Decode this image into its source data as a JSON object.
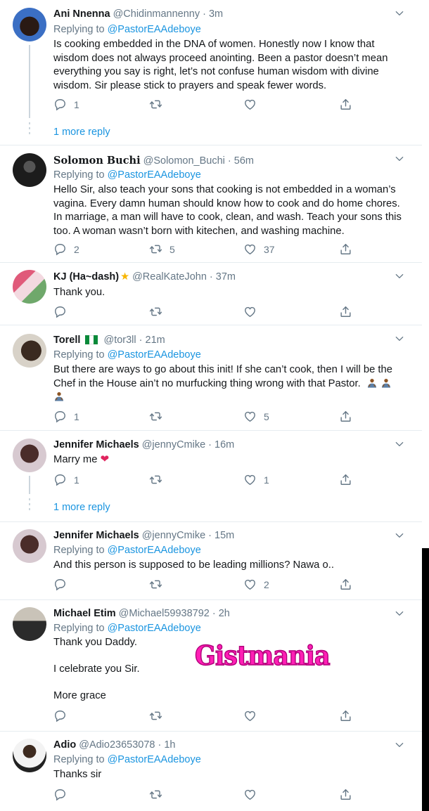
{
  "tweets": [
    {
      "name": "Ani Nnenna",
      "handle": "@Chidinmannenny · 3m",
      "replying": "Replying to ",
      "mention": "@PastorEAAdeboye",
      "text": "Is cooking embedded in the DNA of women. Honestly now I know that wisdom does not always proceed anointing. Been a pastor doesn’t mean everything you say is right, let’s not confuse human wisdom with divine wisdom.  Sir please stick to prayers and speak fewer words.",
      "replies": "1",
      "retweets": "",
      "likes": ""
    },
    {
      "name": "Solomon Buchi",
      "handle": "@Solomon_Buchi · 56m",
      "replying": "Replying to ",
      "mention": "@PastorEAAdeboye",
      "text": "Hello Sir, also teach your sons that cooking is not embedded in a woman’s vagina. Every damn human should know how to cook and do home chores. In marriage, a man will have to cook, clean, and wash. Teach your sons this too. A woman wasn’t born with kitechen, and washing machine.",
      "replies": "2",
      "retweets": "5",
      "likes": "37"
    },
    {
      "name": "KJ (Ha~dash)",
      "handle": "@RealKateJohn · 37m",
      "text": "Thank you.",
      "replies": "",
      "retweets": "",
      "likes": ""
    },
    {
      "name": "Torell",
      "handle": "@tor3ll · 21m",
      "replying": "Replying to ",
      "mention": "@PastorEAAdeboye",
      "text": "But there are ways to go about this init! If she can’t cook, then I will be the Chef in the House ain’t no murfucking thing wrong with that Pastor.",
      "replies": "1",
      "retweets": "",
      "likes": "5"
    },
    {
      "name": "Jennifer Michaels",
      "handle": "@jennyCmike · 16m",
      "text": "Marry me",
      "replies": "1",
      "retweets": "",
      "likes": "1"
    },
    {
      "name": "Jennifer Michaels",
      "handle": "@jennyCmike · 15m",
      "replying": "Replying to ",
      "mention": "@PastorEAAdeboye",
      "text": "And this person is supposed to be leading millions? Nawa o..",
      "replies": "",
      "retweets": "",
      "likes": "2"
    },
    {
      "name": "Michael Etim",
      "handle": "@Michael59938792 · 2h",
      "replying": "Replying to ",
      "mention": "@PastorEAAdeboye",
      "text1": "Thank you Daddy.",
      "text2": "I celebrate you Sir.",
      "text3": "More grace",
      "replies": "",
      "retweets": "",
      "likes": ""
    },
    {
      "name": "Adio",
      "handle": "@Adio23653078 · 1h",
      "replying": "Replying to ",
      "mention": "@PastorEAAdeboye",
      "text": "Thanks sir",
      "replies": "",
      "retweets": "",
      "likes": ""
    }
  ],
  "more_replies": "1 more reply",
  "watermark": "Gistmania",
  "colors": {
    "link": "#1b95e0",
    "meta": "#657786",
    "watermark": "#ff1fb5"
  }
}
